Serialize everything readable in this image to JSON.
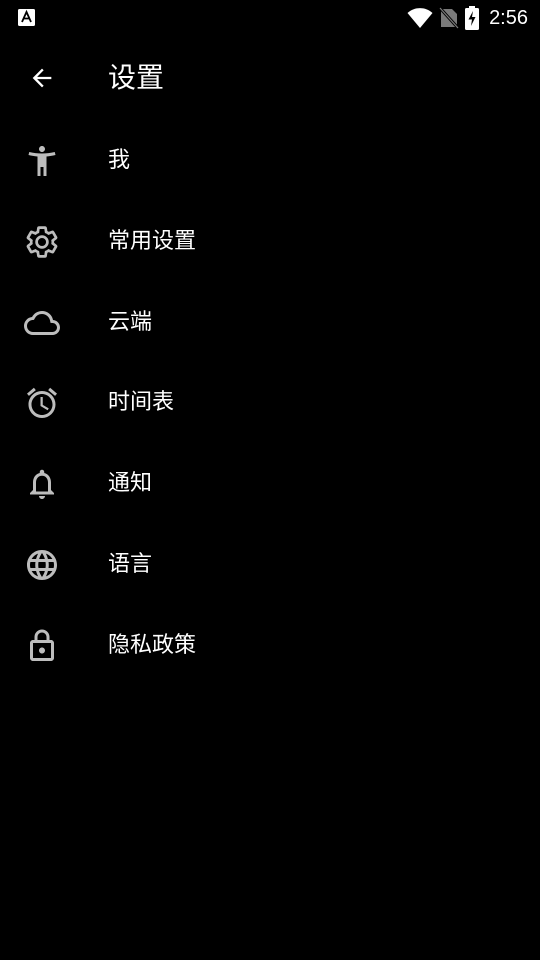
{
  "status_bar": {
    "time": "2:56",
    "app_icon": "a-accessibility-icon",
    "icons": [
      "wifi-icon",
      "no-sim-icon",
      "battery-charging-icon"
    ]
  },
  "header": {
    "title": "设置",
    "back_icon": "arrow-back-icon"
  },
  "menu": {
    "items": [
      {
        "label": "我",
        "icon": "person-icon"
      },
      {
        "label": "常用设置",
        "icon": "gear-icon"
      },
      {
        "label": "云端",
        "icon": "cloud-icon"
      },
      {
        "label": "时间表",
        "icon": "alarm-clock-icon"
      },
      {
        "label": "通知",
        "icon": "bell-icon"
      },
      {
        "label": "语言",
        "icon": "globe-icon"
      },
      {
        "label": "隐私政策",
        "icon": "lock-icon"
      }
    ]
  },
  "colors": {
    "background": "#000000",
    "text": "#ffffff",
    "icon": "#bdbdbd"
  }
}
